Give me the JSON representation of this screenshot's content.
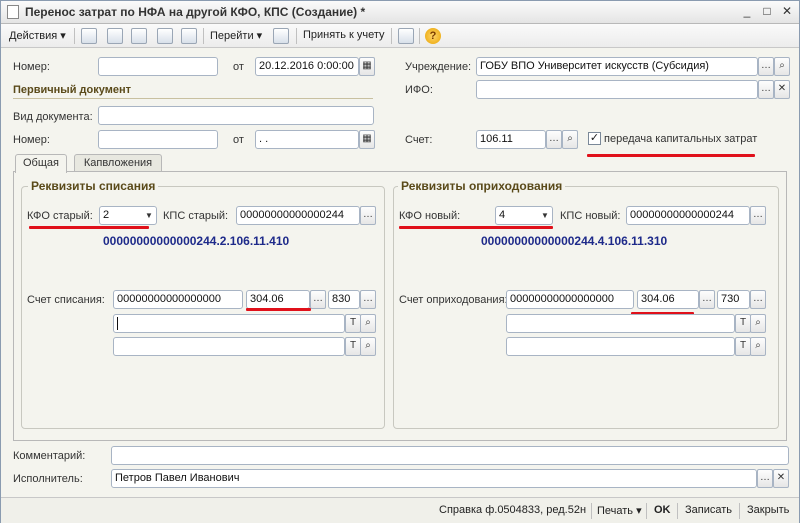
{
  "window": {
    "title": "Перенос затрат по НФА на другой КФО, КПС (Создание) *",
    "minimize": "_",
    "maximize": "□",
    "close": "✕"
  },
  "toolbar": {
    "actions_label": "Действия",
    "goto_label": "Перейти",
    "accept_label": "Принять к учету",
    "help_label": "?"
  },
  "header": {
    "number_label": "Номер:",
    "number_value": "",
    "from_label": "от",
    "date_value": "20.12.2016 0:00:00",
    "institution_label": "Учреждение:",
    "institution_value": "ГОБУ ВПО Университет искусств (Субсидия)",
    "ifo_label": "ИФО:",
    "ifo_value": "",
    "primary_doc_title": "Первичный документ",
    "doc_type_label": "Вид документа:",
    "doc_type_value": "",
    "primary_number_label": "Номер:",
    "primary_number_value": "",
    "primary_from_label": "от",
    "primary_date_value": " .  .",
    "account_label": "Счет:",
    "account_value": "106.11",
    "capital_checkbox_label": "передача капитальных затрат",
    "capital_checked": "✓"
  },
  "tabs": [
    {
      "label": "Общая"
    },
    {
      "label": "Капвложения"
    }
  ],
  "writeoff": {
    "title": "Реквизиты списания",
    "kfo_label": "КФО старый:",
    "kfo_value": "2",
    "kps_label": "КПС старый:",
    "kps_value": "00000000000000244",
    "full_account": "00000000000000244.2.106.11.410",
    "account_label": "Счет списания:",
    "account_code": "00000000000000000",
    "account_value": "304.06",
    "account_ext": "830",
    "sub1": "",
    "sub2": ""
  },
  "posting": {
    "title": "Реквизиты оприходования",
    "kfo_label": "КФО новый:",
    "kfo_value": "4",
    "kps_label": "КПС новый:",
    "kps_value": "00000000000000244",
    "full_account": "00000000000000244.4.106.11.310",
    "account_label": "Счет оприходования:",
    "account_code": "00000000000000000",
    "account_value": "304.06",
    "account_ext": "730",
    "sub1": "",
    "sub2": ""
  },
  "footer": {
    "comment_label": "Комментарий:",
    "comment_value": "",
    "executor_label": "Исполнитель:",
    "executor_value": "Петров Павел Иванович"
  },
  "statusbar": {
    "report_label": "Справка ф.0504833, ред.52н",
    "print_label": "Печать",
    "ok_label": "OK",
    "save_label": "Записать",
    "close_label": "Закрыть"
  },
  "colors": {
    "accent_red": "#e0101a",
    "account_blue": "#1e2a8a",
    "section_title": "#5a4a1a"
  }
}
